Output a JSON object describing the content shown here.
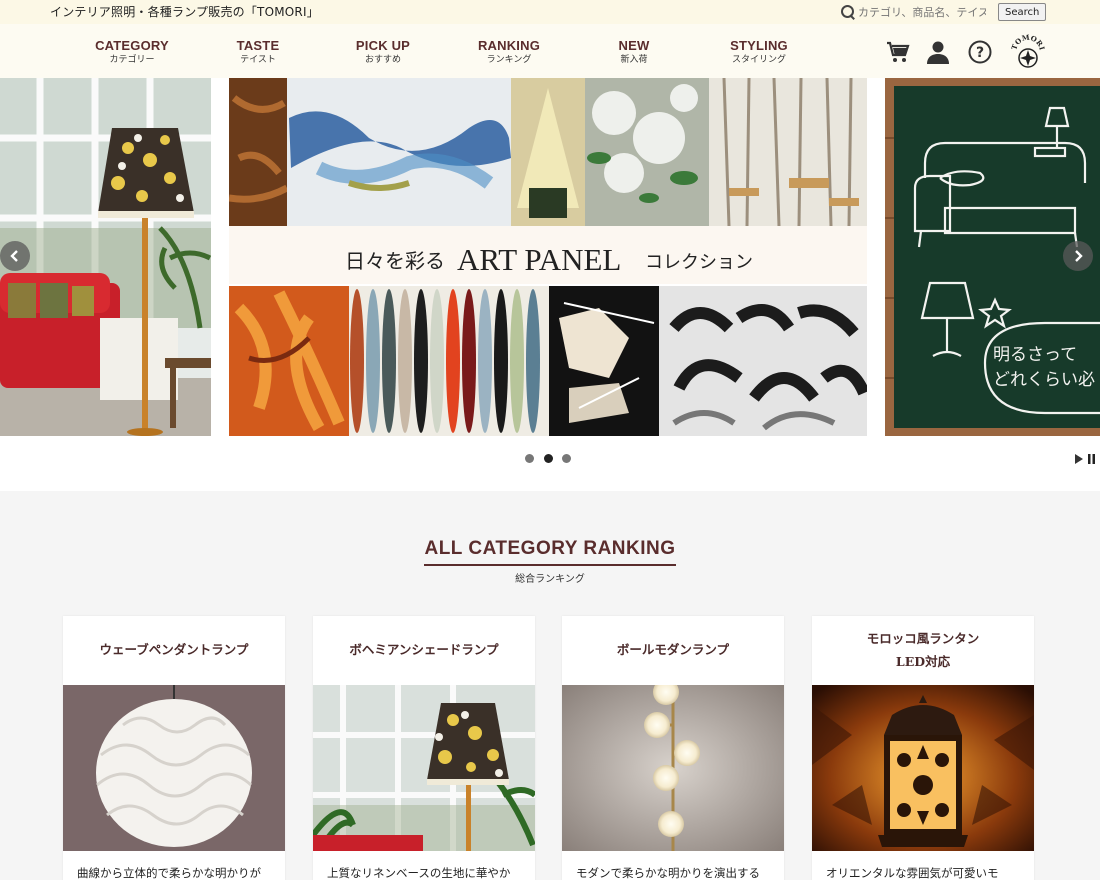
{
  "header": {
    "tagline": "インテリア照明・各種ランプ販売の「TOMORI」",
    "search": {
      "placeholder": "カテゴリ、商品名、テイスト",
      "button_label": "Search"
    }
  },
  "nav": {
    "items": [
      {
        "en": "CATEGORY",
        "ja": "カテゴリー"
      },
      {
        "en": "TASTE",
        "ja": "テイスト"
      },
      {
        "en": "PICK UP",
        "ja": "おすすめ"
      },
      {
        "en": "RANKING",
        "ja": "ランキング"
      },
      {
        "en": "NEW",
        "ja": "新入荷"
      },
      {
        "en": "STYLING",
        "ja": "スタイリング"
      }
    ],
    "logo_text": "TOMORI",
    "icons": [
      "cart-icon",
      "user-icon",
      "help-icon",
      "logo"
    ]
  },
  "hero": {
    "center_banner": {
      "prefix": "日々を彩る",
      "main": "ART PANEL",
      "suffix": "コレクション"
    },
    "right_banner": {
      "line1": "明るさって",
      "line2": "どれくらい必"
    },
    "slider": {
      "count": 3,
      "active_index": 1
    }
  },
  "ranking": {
    "title": "ALL CATEGORY RANKING",
    "subtitle": "総合ランキング",
    "cards": [
      {
        "title": "ウェーブペンダントランプ",
        "desc": "曲線から立体的で柔らかな明かりが"
      },
      {
        "title": "ボヘミアンシェードランプ",
        "desc": "上質なリネンベースの生地に華やか"
      },
      {
        "title": "ボールモダンランプ",
        "desc": "モダンで柔らかな明かりを演出する"
      },
      {
        "title": "モロッコ風ランタン\nLED対応",
        "title_line1": "モロッコ風ランタン",
        "title_line2": "LED対応",
        "desc": "オリエンタルな雰囲気が可愛いモ"
      }
    ]
  },
  "colors": {
    "brand": "#5a2d2d",
    "topbar_bg": "#fcf8e6",
    "nav_bg": "#fdfbf2",
    "page_bg": "#f5f5f5"
  }
}
